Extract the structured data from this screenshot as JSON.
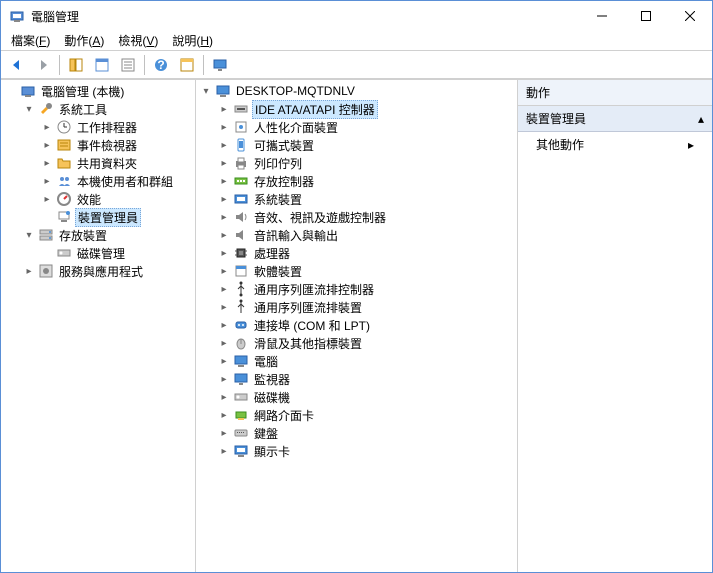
{
  "window": {
    "title": "電腦管理"
  },
  "menu": {
    "file": "檔案(F)",
    "action": "動作(A)",
    "view": "檢視(V)",
    "help": "說明(H)"
  },
  "leftTree": {
    "root": "電腦管理 (本機)",
    "sysTools": "系統工具",
    "taskScheduler": "工作排程器",
    "eventViewer": "事件檢視器",
    "sharedFolders": "共用資料夾",
    "localUsers": "本機使用者和群組",
    "performance": "效能",
    "deviceManager": "裝置管理員",
    "storage": "存放裝置",
    "diskMgmt": "磁碟管理",
    "services": "服務與應用程式"
  },
  "midTree": {
    "root": "DESKTOP-MQTDNLV",
    "ide": "IDE ATA/ATAPI 控制器",
    "hid": "人性化介面裝置",
    "portable": "可攜式裝置",
    "printQueue": "列印佇列",
    "storageCtrl": "存放控制器",
    "sysDevices": "系統裝置",
    "soundVideo": "音效、視訊及遊戲控制器",
    "audioIO": "音訊輸入與輸出",
    "processors": "處理器",
    "software": "軟體裝置",
    "usbCtrl": "通用序列匯流排控制器",
    "usbDev": "通用序列匯流排裝置",
    "ports": "連接埠 (COM 和 LPT)",
    "mouse": "滑鼠及其他指標裝置",
    "computer": "電腦",
    "monitor": "監視器",
    "diskDrive": "磁碟機",
    "network": "網路介面卡",
    "keyboard": "鍵盤",
    "display": "顯示卡"
  },
  "actions": {
    "header": "動作",
    "section": "裝置管理員",
    "more": "其他動作"
  }
}
